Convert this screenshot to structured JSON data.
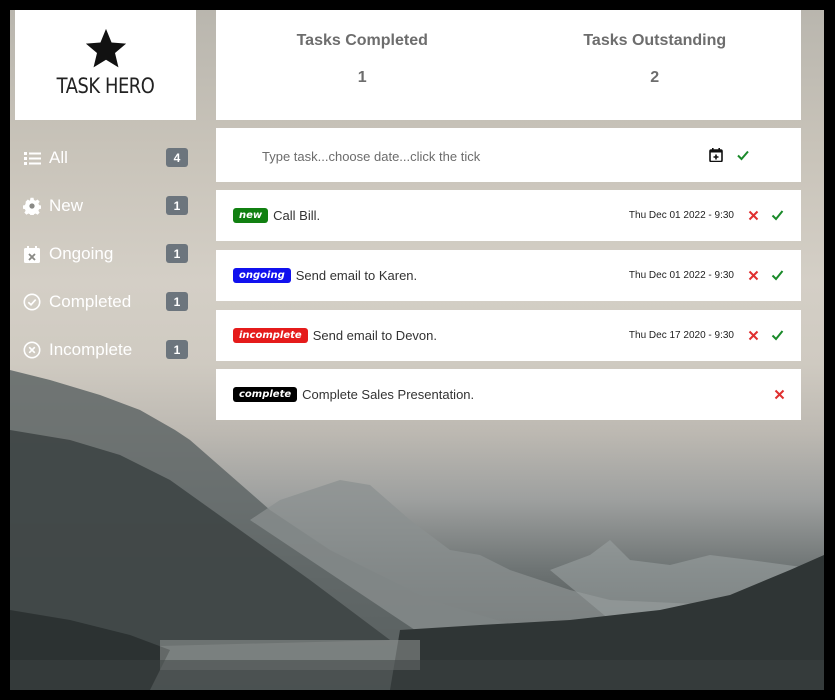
{
  "app": {
    "title": "TASK HERO",
    "logo_icon": "star-icon"
  },
  "colors": {
    "new": "#118011",
    "ongoing": "#1111ee",
    "incomplete": "#e51b1b",
    "complete": "#000000",
    "delete": "#e03030",
    "tick": "#1a8a2a",
    "badge": "#6c757d"
  },
  "sidebar": {
    "items": [
      {
        "label": "All",
        "count": "4",
        "icon": "list-icon"
      },
      {
        "label": "New",
        "count": "1",
        "icon": "gear-icon"
      },
      {
        "label": "Ongoing",
        "count": "1",
        "icon": "calendar-x-icon"
      },
      {
        "label": "Completed",
        "count": "1",
        "icon": "check-circle-icon"
      },
      {
        "label": "Incomplete",
        "count": "1",
        "icon": "x-circle-icon"
      }
    ]
  },
  "stats": {
    "completed_label": "Tasks Completed",
    "completed_value": "1",
    "outstanding_label": "Tasks Outstanding",
    "outstanding_value": "2"
  },
  "input": {
    "placeholder": "Type task...choose date...click the tick",
    "value": ""
  },
  "tasks": [
    {
      "status": "new",
      "text": "Call Bill.",
      "date": "Thu Dec 01 2022 - 9:30"
    },
    {
      "status": "ongoing",
      "text": "Send email to Karen.",
      "date": "Thu Dec 01 2022 - 9:30"
    },
    {
      "status": "incomplete",
      "text": "Send email to Devon.",
      "date": "Thu Dec 17 2020 - 9:30"
    },
    {
      "status": "complete",
      "text": "Complete Sales Presentation.",
      "date": ""
    }
  ]
}
